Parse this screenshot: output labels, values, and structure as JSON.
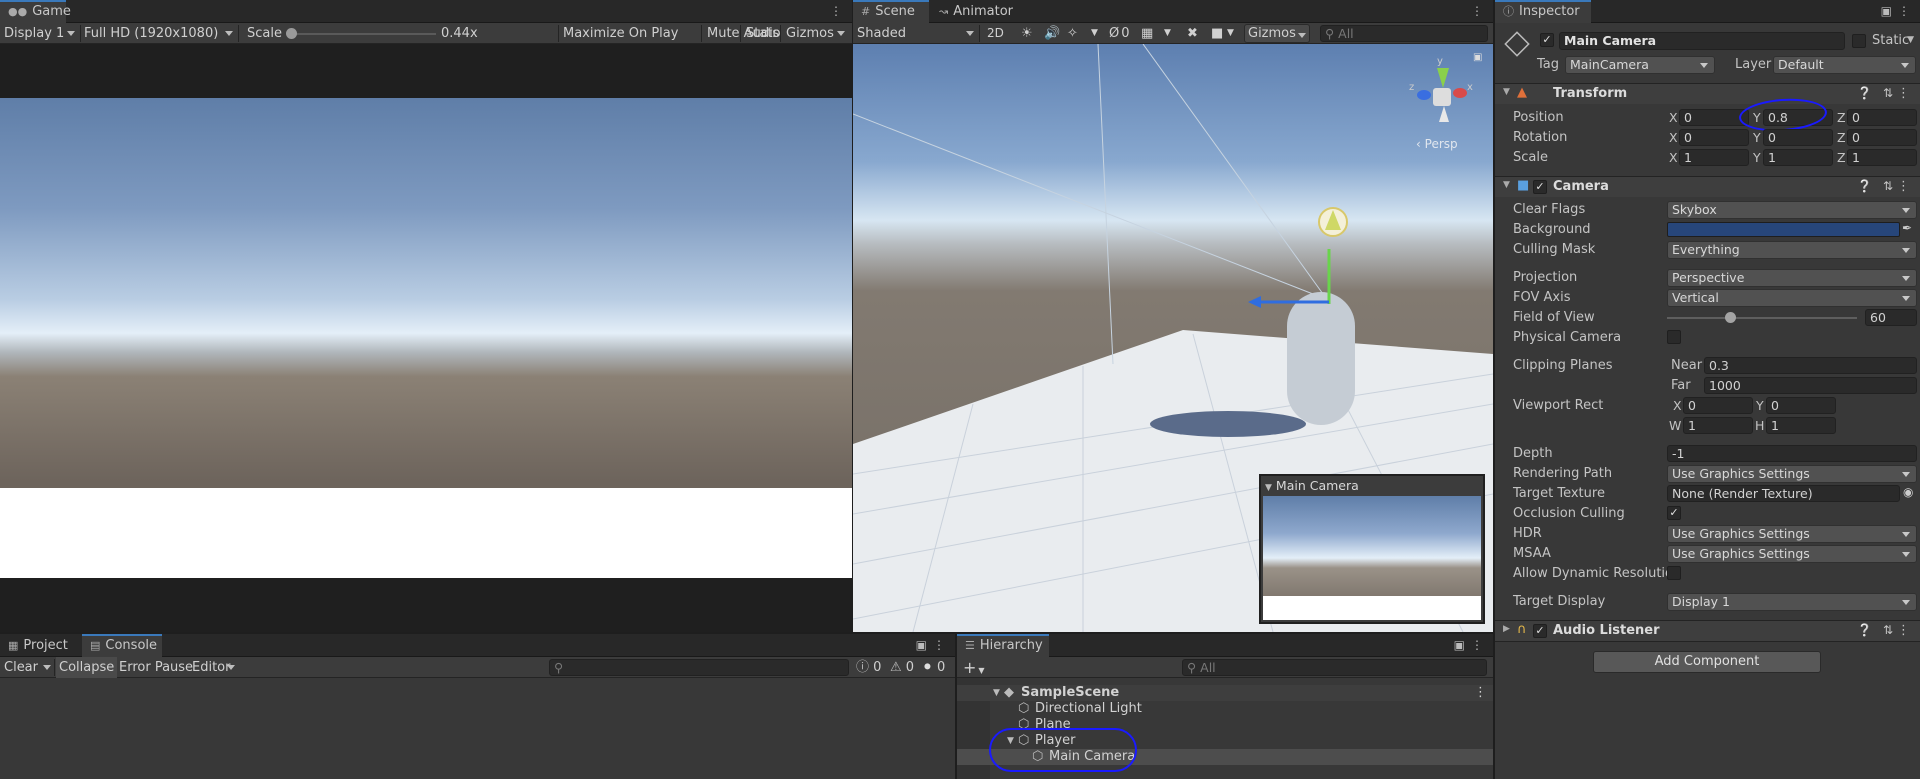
{
  "game": {
    "tab": "Game",
    "display": "Display 1",
    "resolution": "Full HD (1920x1080)",
    "scale_label": "Scale",
    "scale_value": "0.44x",
    "maximize": "Maximize On Play",
    "mute": "Mute Audio",
    "stats": "Stats",
    "gizmos": "Gizmos"
  },
  "scene": {
    "tabs": [
      "Scene",
      "Animator"
    ],
    "shading": "Shaded",
    "mode_2d": "2D",
    "hidden_count": "0",
    "gizmos": "Gizmos",
    "search_placeholder": "All",
    "persp_label": "Persp",
    "overlay_title": "Main Camera",
    "gizmo_axes": {
      "y": "y",
      "z": "z",
      "x": "x"
    }
  },
  "console": {
    "tabs": [
      "Project",
      "Console"
    ],
    "clear": "Clear",
    "collapse": "Collapse",
    "error_pause": "Error Pause",
    "editor": "Editor",
    "counts": {
      "logs": "0",
      "warnings": "0",
      "errors": "0"
    }
  },
  "hierarchy": {
    "tab": "Hierarchy",
    "search_placeholder": "All",
    "scene_name": "SampleScene",
    "items": [
      {
        "label": "Directional Light"
      },
      {
        "label": "Plane"
      },
      {
        "label": "Player"
      },
      {
        "label": "Main Camera"
      }
    ]
  },
  "inspector": {
    "tab": "Inspector",
    "object_name": "Main Camera",
    "static_label": "Static",
    "tag_label": "Tag",
    "tag_value": "MainCamera",
    "layer_label": "Layer",
    "layer_value": "Default",
    "transform": {
      "title": "Transform",
      "position": {
        "label": "Position",
        "x": "0",
        "y": "0.8",
        "z": "0"
      },
      "rotation": {
        "label": "Rotation",
        "x": "0",
        "y": "0",
        "z": "0"
      },
      "scale": {
        "label": "Scale",
        "x": "1",
        "y": "1",
        "z": "1"
      },
      "axis_x": "X",
      "axis_y": "Y",
      "axis_z": "Z"
    },
    "camera": {
      "title": "Camera",
      "clear_flags": {
        "label": "Clear Flags",
        "value": "Skybox"
      },
      "background": {
        "label": "Background",
        "color": "#27467a"
      },
      "culling_mask": {
        "label": "Culling Mask",
        "value": "Everything"
      },
      "projection": {
        "label": "Projection",
        "value": "Perspective"
      },
      "fov_axis": {
        "label": "FOV Axis",
        "value": "Vertical"
      },
      "fov": {
        "label": "Field of View",
        "value": "60",
        "fraction": 0.33
      },
      "physical": {
        "label": "Physical Camera"
      },
      "clipping": {
        "label": "Clipping Planes",
        "near_label": "Near",
        "near": "0.3",
        "far_label": "Far",
        "far": "1000"
      },
      "viewport": {
        "label": "Viewport Rect",
        "x_label": "X",
        "x": "0",
        "y_label": "Y",
        "y": "0",
        "w_label": "W",
        "w": "1",
        "h_label": "H",
        "h": "1"
      },
      "depth": {
        "label": "Depth",
        "value": "-1"
      },
      "rendering_path": {
        "label": "Rendering Path",
        "value": "Use Graphics Settings"
      },
      "target_texture": {
        "label": "Target Texture",
        "value": "None (Render Texture)"
      },
      "occlusion": {
        "label": "Occlusion Culling"
      },
      "hdr": {
        "label": "HDR",
        "value": "Use Graphics Settings"
      },
      "msaa": {
        "label": "MSAA",
        "value": "Use Graphics Settings"
      },
      "dynamic_res": {
        "label": "Allow Dynamic Resolution"
      },
      "target_display": {
        "label": "Target Display",
        "value": "Display 1"
      }
    },
    "audio_listener": {
      "title": "Audio Listener"
    },
    "add_component": "Add Component"
  },
  "colors": {
    "accent": "#3a79bb",
    "annotation": "#1a1aff"
  }
}
